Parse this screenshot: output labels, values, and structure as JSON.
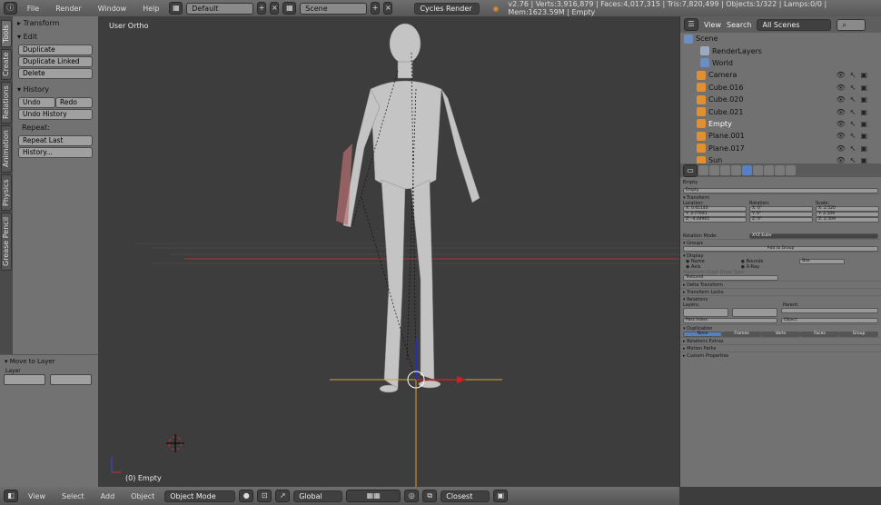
{
  "header": {
    "menus": [
      "File",
      "Render",
      "Window",
      "Help"
    ],
    "layout": "Default",
    "scene": "Scene",
    "engine": "Cycles Render",
    "stats": "v2.76 | Verts:3,916,879 | Faces:4,017,315 | Tris:7,820,499 | Objects:1/322 | Lamps:0/0 | Mem:1623.59M | Empty"
  },
  "tabs": [
    "Tools",
    "Create",
    "Relations",
    "Animation",
    "Physics",
    "Grease Pencil"
  ],
  "tools": {
    "transform": "Transform",
    "edit": "Edit",
    "duplicate": "Duplicate",
    "duplicate_linked": "Duplicate Linked",
    "delete": "Delete",
    "history": "History",
    "undo": "Undo",
    "redo": "Redo",
    "undo_history": "Undo History",
    "repeat": "Repeat:",
    "repeat_last": "Repeat Last",
    "history_btn": "History..."
  },
  "operator": {
    "title": "Move to Layer",
    "layer": "Layer"
  },
  "viewport": {
    "view_label": "User Ortho",
    "object_label": "(0) Empty"
  },
  "bottom": {
    "menus": [
      "View",
      "Select",
      "Add",
      "Object"
    ],
    "mode": "Object Mode",
    "orientation": "Global",
    "snap": "Closest"
  },
  "outliner": {
    "menus": [
      "View",
      "Search"
    ],
    "filter": "All Scenes",
    "items": [
      {
        "name": "Scene",
        "color": "#6a8fc0"
      },
      {
        "name": "RenderLayers",
        "color": "#9aaac0"
      },
      {
        "name": "World",
        "color": "#6a8fc0"
      },
      {
        "name": "Camera",
        "color": "#e09030"
      },
      {
        "name": "Cube.016",
        "color": "#e09030"
      },
      {
        "name": "Cube.020",
        "color": "#e09030"
      },
      {
        "name": "Cube.021",
        "color": "#e09030"
      },
      {
        "name": "Empty",
        "color": "#e09030"
      },
      {
        "name": "Plane.001",
        "color": "#e09030"
      },
      {
        "name": "Plane.017",
        "color": "#e09030"
      },
      {
        "name": "Sun",
        "color": "#e09030"
      }
    ]
  },
  "properties": {
    "breadcrumb": "Empty",
    "name": "Empty",
    "transform": "Transform",
    "location": "Location:",
    "rotation": "Rotation:",
    "scale": "Scale:",
    "loc": [
      "X: 0.61140",
      "Y: 3.77641",
      "Z: -4.44901"
    ],
    "rot": [
      "X: 0°",
      "Y: 0°",
      "Z: 0°"
    ],
    "scl": [
      "X: 2.520",
      "Y: 2.509",
      "Z: 2.509"
    ],
    "rotation_mode_label": "Rotation Mode:",
    "rotation_mode": "XYZ Euler",
    "groups": "Groups",
    "add_to_group": "Add to Group",
    "display": "Display",
    "name_opt": "Name",
    "axis_opt": "Axis",
    "bounds_opt": "Bounds",
    "xray_opt": "X-Ray",
    "box": "Box",
    "max_draw": "Maximum Dupli Draw Type:",
    "textured": "Textured",
    "delta": "Delta Transform",
    "locks": "Transform Locks",
    "relations": "Relations",
    "layers": "Layers:",
    "parent": "Parent:",
    "pass_index": "Pass Index:",
    "object": "Object",
    "duplication": "Duplication",
    "dup_opts": [
      "None",
      "Frames",
      "Verts",
      "Faces",
      "Group"
    ],
    "rel_extras": "Relations Extras",
    "motion_paths": "Motion Paths",
    "custom_props": "Custom Properties"
  }
}
